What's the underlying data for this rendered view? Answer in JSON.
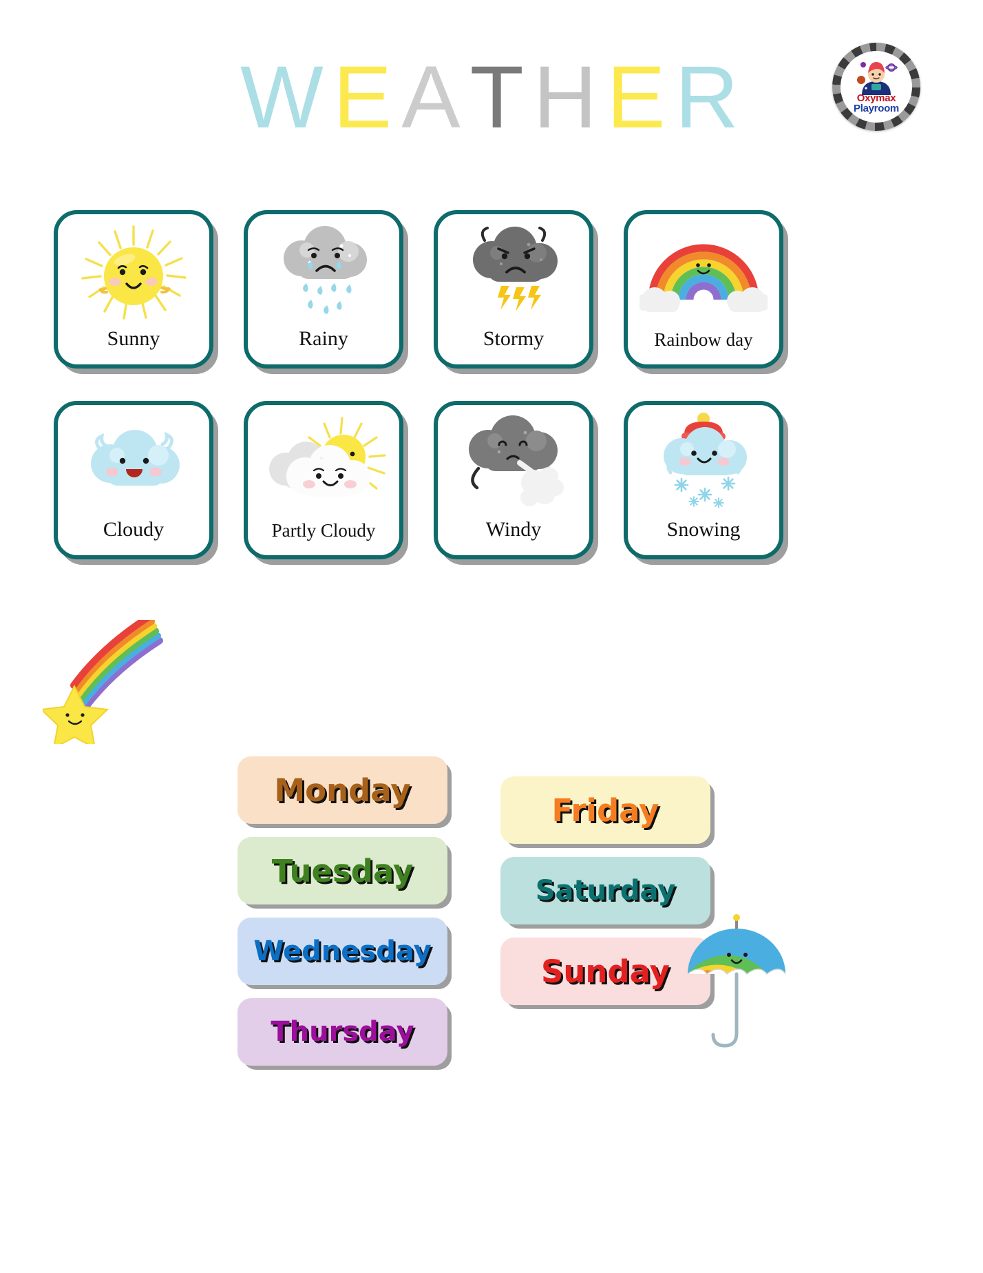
{
  "title": {
    "text": "WEATHER",
    "letters": [
      {
        "ch": "W",
        "color": "#ACDEE6"
      },
      {
        "ch": "E",
        "color": "#FCE94F"
      },
      {
        "ch": "A",
        "color": "#CCCCCC"
      },
      {
        "ch": "T",
        "color": "#7A7A7A"
      },
      {
        "ch": "H",
        "color": "#C4C4C4"
      },
      {
        "ch": "E",
        "color": "#FCE94F"
      },
      {
        "ch": "R",
        "color": "#ACDEE6"
      }
    ]
  },
  "logo": {
    "line1": "Oxymax",
    "line2": "Playroom",
    "line1_color": "#C01822",
    "line2_color": "#1F3FA8"
  },
  "weather_cards": [
    {
      "label": "Sunny",
      "icon": "sun-icon",
      "border_color": "#0E6B6B"
    },
    {
      "label": "Rainy",
      "icon": "rain-cloud-icon",
      "border_color": "#0E6B6B"
    },
    {
      "label": "Stormy",
      "icon": "storm-cloud-icon",
      "border_color": "#0E6B6B"
    },
    {
      "label": "Rainbow day",
      "icon": "rainbow-icon",
      "border_color": "#0E6B6B"
    },
    {
      "label": "Cloudy",
      "icon": "cloud-icon",
      "border_color": "#0E6B6B"
    },
    {
      "label": "Partly Cloudy",
      "icon": "sun-behind-cloud-icon",
      "border_color": "#0E6B6B"
    },
    {
      "label": "Windy",
      "icon": "wind-cloud-icon",
      "border_color": "#0E6B6B"
    },
    {
      "label": "Snowing",
      "icon": "snow-cloud-icon",
      "border_color": "#0E6B6B"
    }
  ],
  "days_left": [
    {
      "label": "Monday",
      "bg": "#FBE0C8",
      "text_color": "#A7611A"
    },
    {
      "label": "Tuesday",
      "bg": "#DCEBCD",
      "text_color": "#3F8020"
    },
    {
      "label": "Wednesday",
      "bg": "#CDDCF5",
      "text_color": "#0C6FC4"
    },
    {
      "label": "Thursday",
      "bg": "#E2CEE8",
      "text_color": "#9B0F9B"
    }
  ],
  "days_right": [
    {
      "label": "Friday",
      "bg": "#FBF4C8",
      "text_color": "#F57C20"
    },
    {
      "label": "Saturday",
      "bg": "#BCE0DE",
      "text_color": "#0C7070"
    },
    {
      "label": "Sunday",
      "bg": "#FADDDD",
      "text_color": "#E32020"
    }
  ],
  "decorations": [
    {
      "name": "shooting-star-rainbow"
    },
    {
      "name": "rainbow-umbrella"
    }
  ]
}
